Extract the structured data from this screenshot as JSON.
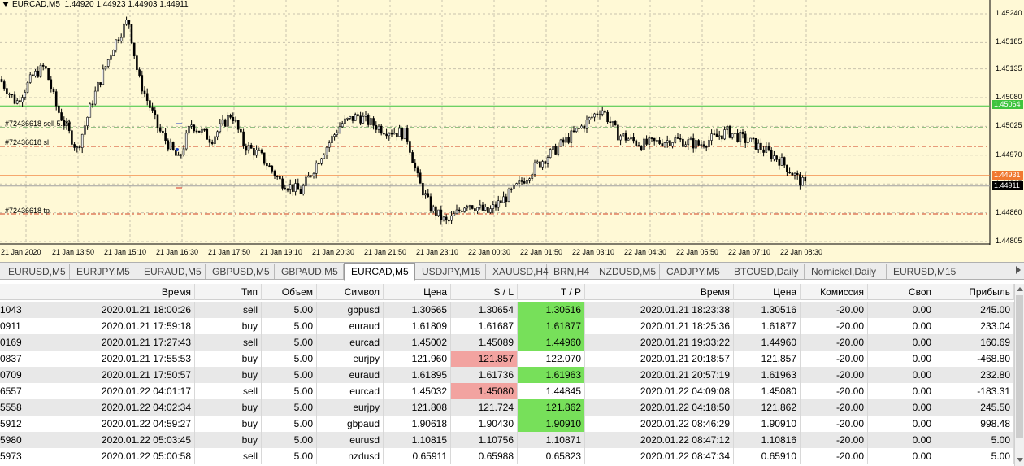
{
  "chart": {
    "symbol_title": "EURCAD,M5",
    "ohlc": "1.44920 1.44923 1.44903 1.44911",
    "price_ticks": [
      "1.45240",
      "1.45185",
      "1.45135",
      "1.45080",
      "1.45025",
      "1.44970",
      "1.44915",
      "1.44860",
      "1.44805"
    ],
    "time_ticks": [
      "21 Jan 2020",
      "21 Jan 13:50",
      "21 Jan 15:10",
      "21 Jan 16:30",
      "21 Jan 17:50",
      "21 Jan 19:10",
      "21 Jan 20:30",
      "21 Jan 21:50",
      "21 Jan 23:10",
      "22 Jan 00:30",
      "22 Jan 01:50",
      "22 Jan 03:10",
      "22 Jan 04:30",
      "22 Jan 05:50",
      "22 Jan 07:10",
      "22 Jan 08:30"
    ],
    "price_flags": {
      "green": "1.45064",
      "orange": "1.44931",
      "current": "1.44911"
    },
    "order_labels": {
      "sell": "#72436618 sell 5.00",
      "sl": "#72436618 sl",
      "tp": "#72436618 tp"
    },
    "colors": {
      "background": "#fff9d6",
      "grid": "#c9c4ae",
      "green_line": "#3ec43e",
      "orange_line": "#f07830",
      "dash_green": "#2e8b2e",
      "dash_red": "#d04020",
      "candle": "#000000"
    }
  },
  "tabs": {
    "items": [
      "EURUSD,M5",
      "EURJPY,M5",
      "EURAUD,M5",
      "GBPUSD,M5",
      "GBPAUD,M5",
      "EURCAD,M5",
      "USDJPY,M15",
      "XAUUSD,H4",
      "BRN,H4",
      "NZDUSD,M5",
      "CADJPY,M5",
      "BTCUSD,Daily",
      "Nornickel,Daily",
      "EURUSD,M15"
    ],
    "active_index": 5
  },
  "table": {
    "headers": [
      "",
      "Время",
      "Тип",
      "Объем",
      "Символ",
      "Цена",
      "S / L",
      "T / P",
      "Время",
      "Цена",
      "Комиссия",
      "Своп",
      "Прибыль"
    ],
    "rows": [
      [
        "1043",
        "2020.01.21 18:00:26",
        "sell",
        "5.00",
        "gbpusd",
        "1.30565",
        "1.30654",
        "1.30516",
        "2020.01.21 18:23:38",
        "1.30516",
        "-20.00",
        "0.00",
        "245.00"
      ],
      [
        "0911",
        "2020.01.21 17:59:18",
        "buy",
        "5.00",
        "euraud",
        "1.61809",
        "1.61687",
        "1.61877",
        "2020.01.21 18:25:36",
        "1.61877",
        "-20.00",
        "0.00",
        "233.04"
      ],
      [
        "0169",
        "2020.01.21 17:27:43",
        "sell",
        "5.00",
        "eurcad",
        "1.45002",
        "1.45089",
        "1.44960",
        "2020.01.21 19:33:22",
        "1.44960",
        "-20.00",
        "0.00",
        "160.69"
      ],
      [
        "0837",
        "2020.01.21 17:55:53",
        "buy",
        "5.00",
        "eurjpy",
        "121.960",
        "121.857",
        "122.070",
        "2020.01.21 20:18:57",
        "121.857",
        "-20.00",
        "0.00",
        "-468.80"
      ],
      [
        "0709",
        "2020.01.21 17:50:57",
        "buy",
        "5.00",
        "euraud",
        "1.61895",
        "1.61736",
        "1.61963",
        "2020.01.21 20:57:19",
        "1.61963",
        "-20.00",
        "0.00",
        "232.80"
      ],
      [
        "6557",
        "2020.01.22 04:01:17",
        "sell",
        "5.00",
        "eurcad",
        "1.45032",
        "1.45080",
        "1.44845",
        "2020.01.22 04:09:08",
        "1.45080",
        "-20.00",
        "0.00",
        "-183.31"
      ],
      [
        "5558",
        "2020.01.22 04:02:34",
        "buy",
        "5.00",
        "eurjpy",
        "121.808",
        "121.724",
        "121.862",
        "2020.01.22 04:18:50",
        "121.862",
        "-20.00",
        "0.00",
        "245.50"
      ],
      [
        "5912",
        "2020.01.22 04:59:27",
        "buy",
        "5.00",
        "gbpaud",
        "1.90618",
        "1.90430",
        "1.90910",
        "2020.01.22 08:46:29",
        "1.90910",
        "-20.00",
        "0.00",
        "998.48"
      ],
      [
        "5980",
        "2020.01.22 05:03:45",
        "buy",
        "5.00",
        "eurusd",
        "1.10815",
        "1.10756",
        "1.10871",
        "2020.01.22 08:47:12",
        "1.10816",
        "-20.00",
        "0.00",
        "5.00"
      ],
      [
        "5973",
        "2020.01.22 05:00:58",
        "sell",
        "5.00",
        "nzdusd",
        "0.65911",
        "0.65988",
        "0.65823",
        "2020.01.22 08:47:34",
        "0.65910",
        "-20.00",
        "0.00",
        "5.00"
      ]
    ],
    "highlights": [
      {
        "row": 0,
        "col": 7,
        "color": "green"
      },
      {
        "row": 1,
        "col": 7,
        "color": "green"
      },
      {
        "row": 2,
        "col": 7,
        "color": "green"
      },
      {
        "row": 3,
        "col": 6,
        "color": "red"
      },
      {
        "row": 4,
        "col": 7,
        "color": "green"
      },
      {
        "row": 5,
        "col": 6,
        "color": "red"
      },
      {
        "row": 6,
        "col": 7,
        "color": "green"
      },
      {
        "row": 7,
        "col": 7,
        "color": "green"
      }
    ]
  }
}
